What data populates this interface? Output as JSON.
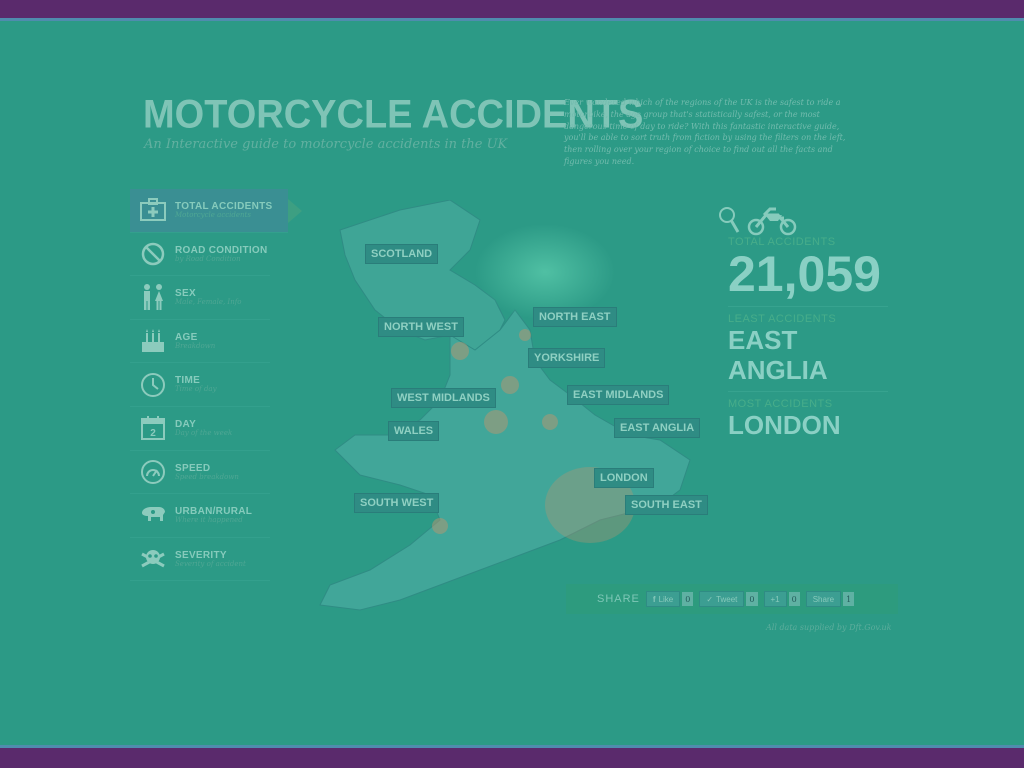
{
  "header": {
    "title": "MOTORCYCLE ACCIDENTS",
    "subtitle": "An Interactive guide to motorcycle accidents in the UK",
    "intro": "Ever wondered which of the regions of the UK is the safest to ride a motorbike, the age group that's statistically safest, or the most dangerous time of day to ride? With this fantastic interactive guide, you'll be able to sort truth from fiction by using the filters on the left, then rolling over your region of choice to find out all the facts and figures you need."
  },
  "filters": [
    {
      "label": "TOTAL ACCIDENTS",
      "sublabel": "Motorcycle accidents",
      "icon": "first-aid-icon",
      "active": true
    },
    {
      "label": "ROAD CONDITION",
      "sublabel": "by Road Condition",
      "icon": "no-entry-icon",
      "active": false
    },
    {
      "label": "SEX",
      "sublabel": "Male, Female, Info",
      "icon": "male-female-icon",
      "active": false
    },
    {
      "label": "AGE",
      "sublabel": "Breakdown",
      "icon": "birthday-cake-icon",
      "active": false
    },
    {
      "label": "TIME",
      "sublabel": "Time of day",
      "icon": "clock-icon",
      "active": false
    },
    {
      "label": "DAY",
      "sublabel": "Day of the week",
      "icon": "calendar-icon",
      "active": false
    },
    {
      "label": "SPEED",
      "sublabel": "Speed breakdown",
      "icon": "speedometer-icon",
      "active": false
    },
    {
      "label": "URBAN/RURAL",
      "sublabel": "Where it happened",
      "icon": "cow-icon",
      "active": false
    },
    {
      "label": "SEVERITY",
      "sublabel": "Severity of accident",
      "icon": "skull-crossbones-icon",
      "active": false
    }
  ],
  "map": {
    "regions": [
      "SCOTLAND",
      "NORTH WEST",
      "NORTH EAST",
      "YORKSHIRE",
      "EAST MIDLANDS",
      "WEST MIDLANDS",
      "WALES",
      "EAST ANGLIA",
      "LONDON",
      "SOUTH EAST",
      "SOUTH WEST"
    ]
  },
  "stats": {
    "total_label": "TOTAL ACCIDENTS",
    "total_value": "21,059",
    "least_label": "LEAST ACCIDENTS",
    "least_value": "EAST ANGLIA",
    "most_label": "MOST ACCIDENTS",
    "most_value": "LONDON",
    "icons": [
      "magnifier-icon",
      "motorcycle-icon"
    ]
  },
  "share": {
    "label": "SHARE",
    "buttons": [
      {
        "label": "Like",
        "count": "0",
        "icon": "facebook-icon"
      },
      {
        "label": "Tweet",
        "count": "0",
        "icon": "twitter-icon"
      },
      {
        "label": "+1",
        "count": "0",
        "icon": "google-plus-icon"
      },
      {
        "label": "Share",
        "count": "1",
        "icon": "linkedin-icon"
      }
    ]
  },
  "credit": {
    "prefix": "All data supplied by ",
    "link": "Dft.Gov.uk"
  },
  "colors": {
    "background": "#2c9a86",
    "torn_edge": "#5a2a6c",
    "accent": "#8ad0c4",
    "marker": "#b9956f"
  }
}
